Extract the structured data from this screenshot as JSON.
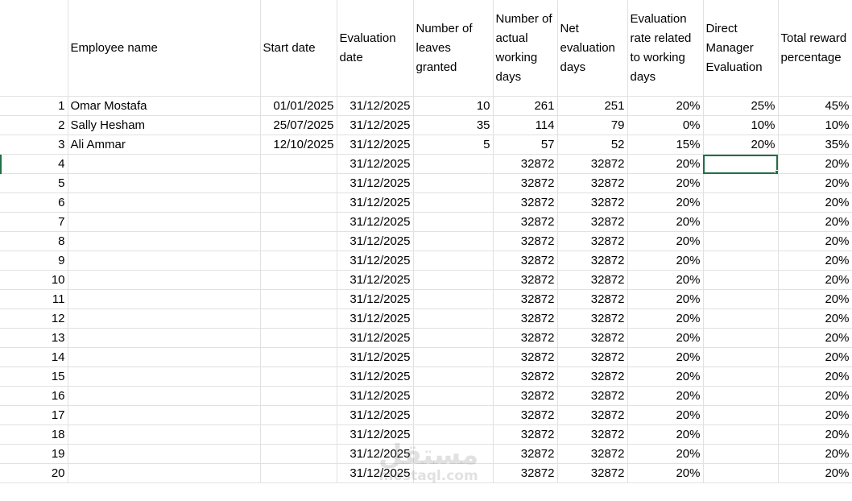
{
  "headers": [
    "",
    "Employee name",
    "Start date",
    "Evaluation date",
    "Number of leaves granted",
    "Number of actual working days",
    "Net evaluation days",
    "Evaluation rate related to working days",
    "Direct Manager Evaluation",
    "Total reward percentage"
  ],
  "rows": [
    [
      "1",
      "Omar Mostafa",
      "01/01/2025",
      "31/12/2025",
      "10",
      "261",
      "251",
      "20%",
      "25%",
      "45%"
    ],
    [
      "2",
      "Sally Hesham",
      "25/07/2025",
      "31/12/2025",
      "35",
      "114",
      "79",
      "0%",
      "10%",
      "10%"
    ],
    [
      "3",
      "Ali Ammar",
      "12/10/2025",
      "31/12/2025",
      "5",
      "57",
      "52",
      "15%",
      "20%",
      "35%"
    ],
    [
      "4",
      "",
      "",
      "31/12/2025",
      "",
      "32872",
      "32872",
      "20%",
      "",
      "20%"
    ],
    [
      "5",
      "",
      "",
      "31/12/2025",
      "",
      "32872",
      "32872",
      "20%",
      "",
      "20%"
    ],
    [
      "6",
      "",
      "",
      "31/12/2025",
      "",
      "32872",
      "32872",
      "20%",
      "",
      "20%"
    ],
    [
      "7",
      "",
      "",
      "31/12/2025",
      "",
      "32872",
      "32872",
      "20%",
      "",
      "20%"
    ],
    [
      "8",
      "",
      "",
      "31/12/2025",
      "",
      "32872",
      "32872",
      "20%",
      "",
      "20%"
    ],
    [
      "9",
      "",
      "",
      "31/12/2025",
      "",
      "32872",
      "32872",
      "20%",
      "",
      "20%"
    ],
    [
      "10",
      "",
      "",
      "31/12/2025",
      "",
      "32872",
      "32872",
      "20%",
      "",
      "20%"
    ],
    [
      "11",
      "",
      "",
      "31/12/2025",
      "",
      "32872",
      "32872",
      "20%",
      "",
      "20%"
    ],
    [
      "12",
      "",
      "",
      "31/12/2025",
      "",
      "32872",
      "32872",
      "20%",
      "",
      "20%"
    ],
    [
      "13",
      "",
      "",
      "31/12/2025",
      "",
      "32872",
      "32872",
      "20%",
      "",
      "20%"
    ],
    [
      "14",
      "",
      "",
      "31/12/2025",
      "",
      "32872",
      "32872",
      "20%",
      "",
      "20%"
    ],
    [
      "15",
      "",
      "",
      "31/12/2025",
      "",
      "32872",
      "32872",
      "20%",
      "",
      "20%"
    ],
    [
      "16",
      "",
      "",
      "31/12/2025",
      "",
      "32872",
      "32872",
      "20%",
      "",
      "20%"
    ],
    [
      "17",
      "",
      "",
      "31/12/2025",
      "",
      "32872",
      "32872",
      "20%",
      "",
      "20%"
    ],
    [
      "18",
      "",
      "",
      "31/12/2025",
      "",
      "32872",
      "32872",
      "20%",
      "",
      "20%"
    ],
    [
      "19",
      "",
      "",
      "31/12/2025",
      "",
      "32872",
      "32872",
      "20%",
      "",
      "20%"
    ],
    [
      "20",
      "",
      "",
      "31/12/2025",
      "",
      "32872",
      "32872",
      "20%",
      "",
      "20%"
    ]
  ],
  "selection": {
    "row_label": "4",
    "column_header": "Direct Manager Evaluation"
  },
  "watermark": {
    "arabic": "مستقل",
    "latin": "mostaql.com"
  },
  "colors": {
    "gridline": "#e1e1e1",
    "selection": "#1e7145",
    "text": "#000000",
    "background": "#ffffff"
  }
}
